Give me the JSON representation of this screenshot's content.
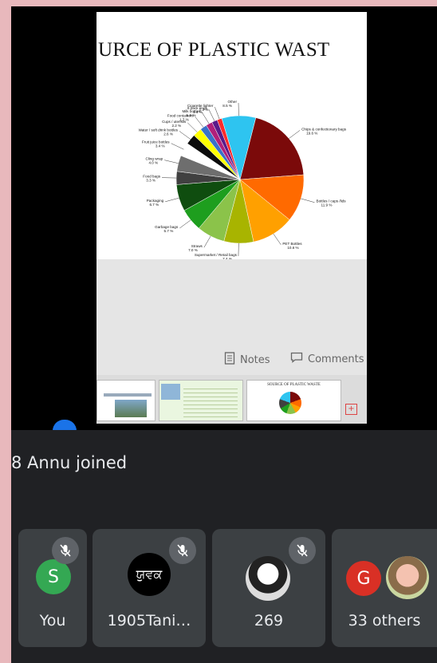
{
  "slide": {
    "title": "URCE OF PLASTIC WAST",
    "notes_label": "Notes",
    "comments_label": "Comments",
    "thumb_title": "SOURCE OF PLASTIC WASTE"
  },
  "chart_data": {
    "type": "pie",
    "labels": [
      "Chips & confectionary bags",
      "Bottles / caps /lids",
      "PET Bottles",
      "Supermarket / Retail bags",
      "Straws",
      "Garbage bags",
      "Packaging",
      "Food bags",
      "Cling wrap",
      "Fruit juice bottles",
      "Water / soft drink bottles",
      "Cups / utensils",
      "Food containers",
      "Milk bottles",
      "6 pack rings",
      "Cigarette lighter",
      "Other"
    ],
    "value_labels": [
      "19.6 %",
      "11.9 %",
      "10.6 %",
      "7.4 %",
      "7.0 %",
      "5.7 %",
      "6.7 %",
      "3.3 %",
      "4.0 %",
      "3.4 %",
      "2.6 %",
      "2.2 %",
      "1.7 %",
      "1.6 %",
      "1.4 %",
      "1.2 %",
      "8.5 %"
    ],
    "values": [
      19.6,
      11.9,
      10.6,
      7.4,
      7.0,
      5.7,
      6.7,
      3.3,
      4.0,
      3.4,
      2.6,
      2.2,
      1.7,
      1.6,
      1.4,
      1.2,
      8.5
    ],
    "colors": [
      "#7b0a0a",
      "#ff6a00",
      "#ffa000",
      "#a8b400",
      "#8bc34a",
      "#1e9e1e",
      "#0f4d0f",
      "#404040",
      "#6e6e6e",
      "#ffffff",
      "#0c0c0c",
      "#ffff00",
      "#3a72c8",
      "#b0207a",
      "#5a1a8a",
      "#ff2a2a",
      "#2ec4f0"
    ]
  },
  "call": {
    "toast": "8 Annu joined",
    "participants": [
      {
        "label": "You",
        "initial": "S",
        "color": "#34a853",
        "muted": true
      },
      {
        "label": "1905Tani…",
        "logo_text": "ਯੁਵਕ",
        "muted": true
      },
      {
        "label": "269",
        "muted": true
      },
      {
        "label": "33 others",
        "initial": "G",
        "color": "#d93025",
        "muted": false
      }
    ]
  }
}
